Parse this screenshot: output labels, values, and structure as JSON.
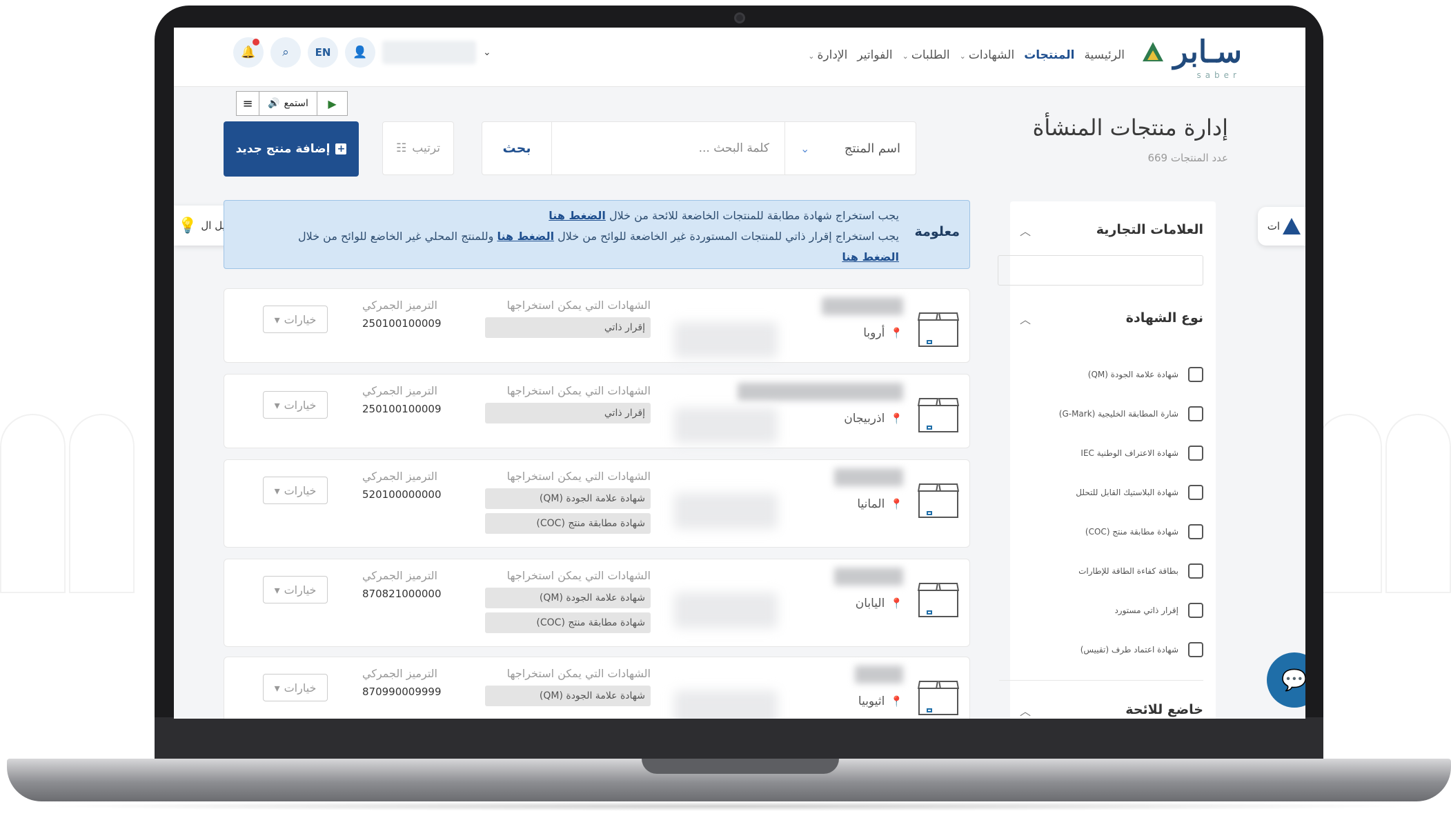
{
  "header": {
    "logo_text": "سـابر",
    "logo_sub": "saber",
    "nav": [
      {
        "label": "الرئيسية",
        "active": false,
        "dropdown": false
      },
      {
        "label": "المنتجات",
        "active": true,
        "dropdown": false
      },
      {
        "label": "الشهادات",
        "active": false,
        "dropdown": true
      },
      {
        "label": "الطلبات",
        "active": false,
        "dropdown": true
      },
      {
        "label": "الفواتير",
        "active": false,
        "dropdown": false
      },
      {
        "label": "الإدارة",
        "active": false,
        "dropdown": true
      }
    ],
    "lang_button": "EN",
    "accent_color": "#1f4f8f"
  },
  "listen_bar": {
    "listen_label": "استمع"
  },
  "page": {
    "title": "إدارة منتجات المنشأة",
    "count_label": "عدد المنتجات 669"
  },
  "search": {
    "field_select": "اسم المنتج",
    "placeholder": "كلمة البحث ...",
    "search_button": "بحث",
    "sort_button": "ترتيب",
    "add_button": "إضافة منتج جديد"
  },
  "sidebar": {
    "brands_title": "العلامات التجارية",
    "cert_type_title": "نوع الشهادة",
    "cert_types": [
      "شهادة علامة الجودة (QM)",
      "شارة المطابقة الخليجية (G-Mark)",
      "شهادة الاعتراف الوطنية IEC",
      "شهادة البلاستيك القابل للتحلل",
      "شهادة مطابقة منتج (COC)",
      "بطاقة كفاءة الطاقة للإطارات",
      "إقرار ذاتي مستورد",
      "شهادة اعتماد طرف (تقييس)"
    ],
    "regulated_title": "خاضع للائحة",
    "side_tab_label": "ات",
    "guide_tab_label": "دليل ال"
  },
  "info": {
    "title": "معلومة",
    "line1": "يجب استخراج شهادة مطابقة للمنتجات الخاضعة للائحة من خلال",
    "line1_link": "الضغط هنا",
    "line2": "يجب استخراج إقرار ذاتي للمنتجات المستوردة غير الخاضعة للوائح من خلال",
    "line2_link": "الضغط هنا",
    "line2_tail": "وللمنتج المحلي غير الخاضع للوائح من خلال",
    "line3_link": "الضغط هنا"
  },
  "products": [
    {
      "origin": "أروبا",
      "certs_label": "الشهادات التي يمكن استخراجها",
      "certs": [
        "إقرار ذاتي"
      ],
      "hs_label": "الترميز الجمركي",
      "hs": "250100100009",
      "options": "خيارات"
    },
    {
      "origin": "اذربيجان",
      "certs_label": "الشهادات التي يمكن استخراجها",
      "certs": [
        "إقرار ذاتي"
      ],
      "hs_label": "الترميز الجمركي",
      "hs": "250100100009",
      "options": "خيارات"
    },
    {
      "origin": "المانيا",
      "certs_label": "الشهادات التي يمكن استخراجها",
      "certs": [
        "شهادة علامة الجودة (QM)",
        "شهادة مطابقة منتج (COC)"
      ],
      "hs_label": "الترميز الجمركي",
      "hs": "520100000000",
      "options": "خيارات"
    },
    {
      "origin": "اليابان",
      "certs_label": "الشهادات التي يمكن استخراجها",
      "certs": [
        "شهادة علامة الجودة (QM)",
        "شهادة مطابقة منتج (COC)"
      ],
      "hs_label": "الترميز الجمركي",
      "hs": "870821000000",
      "options": "خيارات"
    },
    {
      "origin": "اثيوبيا",
      "certs_label": "الشهادات التي يمكن استخراجها",
      "certs": [
        "شهادة علامة الجودة (QM)"
      ],
      "hs_label": "الترميز الجمركي",
      "hs": "870990009999",
      "options": "خيارات"
    }
  ]
}
